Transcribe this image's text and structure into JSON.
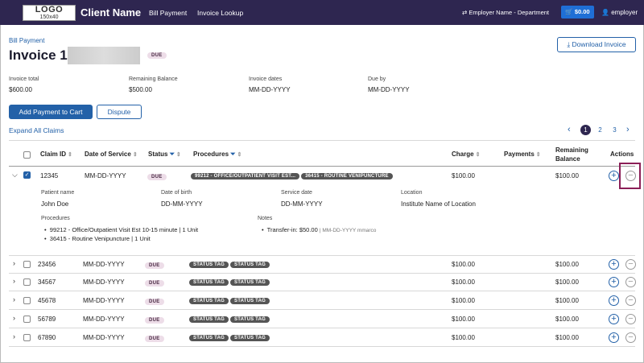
{
  "nav": {
    "logo_text": "LOGO",
    "logo_size": "150x40",
    "client_name": "Client Name",
    "links": [
      "Bill Payment",
      "Invoice Lookup"
    ],
    "employer": "Employer Name - Department",
    "cart": "$0.00",
    "user": "employer"
  },
  "header": {
    "breadcrumb": "Bill Payment",
    "title": "Invoice 1",
    "status": "DUE",
    "download": "Download Invoice"
  },
  "summary": [
    {
      "label": "Invoice total",
      "value": "$600.00"
    },
    {
      "label": "Remaining Balance",
      "value": "$500.00"
    },
    {
      "label": "Invoice dates",
      "value": "MM-DD-YYYY"
    },
    {
      "label": "Due by",
      "value": "MM-DD-YYYY"
    }
  ],
  "actions": {
    "add": "Add Payment to Cart",
    "dispute": "Dispute",
    "expand": "Expand All Claims"
  },
  "pagination": {
    "pages": [
      "1",
      "2",
      "3"
    ],
    "current": "1"
  },
  "columns": {
    "claim_id": "Claim ID",
    "date": "Date of Service",
    "status": "Status",
    "procedures": "Procedures",
    "charge": "Charge",
    "payments": "Payments",
    "remaining1": "Remaining",
    "remaining2": "Balance",
    "actions": "Actions"
  },
  "expanded": {
    "id": "12345",
    "date": "MM-DD-YYYY",
    "status": "DUE",
    "tags": [
      "99212 - OFFICE/OUTPATIENT VISIT EST...",
      "36415 - ROUTINE VENIPUNCTURE"
    ],
    "charge": "$100.00",
    "remaining": "$100.00",
    "details": {
      "patient_label": "Patient name",
      "patient": "John Doe",
      "dob_label": "Date of birth",
      "dob": "DD-MM-YYYY",
      "service_label": "Service date",
      "service": "DD-MM-YYYY",
      "location_label": "Location",
      "location": "Institute Name of Location",
      "procedures_label": "Procedures",
      "procedures": [
        "99212 - Office/Outpatient Visit Est 10-15 minute | 1 Unit",
        "36415 - Routine Venipuncture | 1 Unit"
      ],
      "notes_label": "Notes",
      "note": "Transfer-in: $50.00",
      "note_meta": "| MM-DD-YYYY mmarco"
    }
  },
  "rows": [
    {
      "id": "23456",
      "date": "MM-DD-YYYY",
      "status": "DUE",
      "tag1": "STATUS TAG",
      "tag2": "STATUS TAG",
      "charge": "$100.00",
      "remaining": "$100.00"
    },
    {
      "id": "34567",
      "date": "MM-DD-YYYY",
      "status": "DUE",
      "tag1": "STATUS TAG",
      "tag2": "STATUS TAG",
      "charge": "$100.00",
      "remaining": "$100.00"
    },
    {
      "id": "45678",
      "date": "MM-DD-YYYY",
      "status": "DUE",
      "tag1": "STATUS TAG",
      "tag2": "STATUS TAG",
      "charge": "$100.00",
      "remaining": "$100.00"
    },
    {
      "id": "56789",
      "date": "MM-DD-YYYY",
      "status": "DUE",
      "tag1": "STATUS TAG",
      "tag2": "STATUS TAG",
      "charge": "$100.00",
      "remaining": "$100.00"
    },
    {
      "id": "67890",
      "date": "MM-DD-YYYY",
      "status": "DUE",
      "tag1": "STATUS TAG",
      "tag2": "STATUS TAG",
      "charge": "$100.00",
      "remaining": "$100.00"
    }
  ],
  "colors": {
    "nav": "#2e2650",
    "accent": "#2361a8",
    "highlight": "#8b1f57"
  }
}
